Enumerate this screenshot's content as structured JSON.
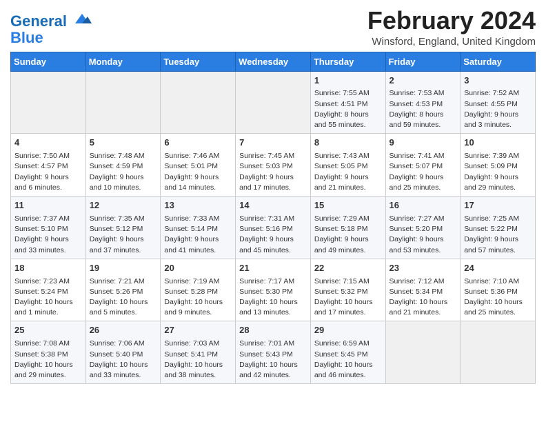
{
  "logo": {
    "line1": "General",
    "line2": "Blue"
  },
  "title": "February 2024",
  "location": "Winsford, England, United Kingdom",
  "days_of_week": [
    "Sunday",
    "Monday",
    "Tuesday",
    "Wednesday",
    "Thursday",
    "Friday",
    "Saturday"
  ],
  "weeks": [
    [
      {
        "day": "",
        "content": ""
      },
      {
        "day": "",
        "content": ""
      },
      {
        "day": "",
        "content": ""
      },
      {
        "day": "",
        "content": ""
      },
      {
        "day": "1",
        "content": "Sunrise: 7:55 AM\nSunset: 4:51 PM\nDaylight: 8 hours\nand 55 minutes."
      },
      {
        "day": "2",
        "content": "Sunrise: 7:53 AM\nSunset: 4:53 PM\nDaylight: 8 hours\nand 59 minutes."
      },
      {
        "day": "3",
        "content": "Sunrise: 7:52 AM\nSunset: 4:55 PM\nDaylight: 9 hours\nand 3 minutes."
      }
    ],
    [
      {
        "day": "4",
        "content": "Sunrise: 7:50 AM\nSunset: 4:57 PM\nDaylight: 9 hours\nand 6 minutes."
      },
      {
        "day": "5",
        "content": "Sunrise: 7:48 AM\nSunset: 4:59 PM\nDaylight: 9 hours\nand 10 minutes."
      },
      {
        "day": "6",
        "content": "Sunrise: 7:46 AM\nSunset: 5:01 PM\nDaylight: 9 hours\nand 14 minutes."
      },
      {
        "day": "7",
        "content": "Sunrise: 7:45 AM\nSunset: 5:03 PM\nDaylight: 9 hours\nand 17 minutes."
      },
      {
        "day": "8",
        "content": "Sunrise: 7:43 AM\nSunset: 5:05 PM\nDaylight: 9 hours\nand 21 minutes."
      },
      {
        "day": "9",
        "content": "Sunrise: 7:41 AM\nSunset: 5:07 PM\nDaylight: 9 hours\nand 25 minutes."
      },
      {
        "day": "10",
        "content": "Sunrise: 7:39 AM\nSunset: 5:09 PM\nDaylight: 9 hours\nand 29 minutes."
      }
    ],
    [
      {
        "day": "11",
        "content": "Sunrise: 7:37 AM\nSunset: 5:10 PM\nDaylight: 9 hours\nand 33 minutes."
      },
      {
        "day": "12",
        "content": "Sunrise: 7:35 AM\nSunset: 5:12 PM\nDaylight: 9 hours\nand 37 minutes."
      },
      {
        "day": "13",
        "content": "Sunrise: 7:33 AM\nSunset: 5:14 PM\nDaylight: 9 hours\nand 41 minutes."
      },
      {
        "day": "14",
        "content": "Sunrise: 7:31 AM\nSunset: 5:16 PM\nDaylight: 9 hours\nand 45 minutes."
      },
      {
        "day": "15",
        "content": "Sunrise: 7:29 AM\nSunset: 5:18 PM\nDaylight: 9 hours\nand 49 minutes."
      },
      {
        "day": "16",
        "content": "Sunrise: 7:27 AM\nSunset: 5:20 PM\nDaylight: 9 hours\nand 53 minutes."
      },
      {
        "day": "17",
        "content": "Sunrise: 7:25 AM\nSunset: 5:22 PM\nDaylight: 9 hours\nand 57 minutes."
      }
    ],
    [
      {
        "day": "18",
        "content": "Sunrise: 7:23 AM\nSunset: 5:24 PM\nDaylight: 10 hours\nand 1 minute."
      },
      {
        "day": "19",
        "content": "Sunrise: 7:21 AM\nSunset: 5:26 PM\nDaylight: 10 hours\nand 5 minutes."
      },
      {
        "day": "20",
        "content": "Sunrise: 7:19 AM\nSunset: 5:28 PM\nDaylight: 10 hours\nand 9 minutes."
      },
      {
        "day": "21",
        "content": "Sunrise: 7:17 AM\nSunset: 5:30 PM\nDaylight: 10 hours\nand 13 minutes."
      },
      {
        "day": "22",
        "content": "Sunrise: 7:15 AM\nSunset: 5:32 PM\nDaylight: 10 hours\nand 17 minutes."
      },
      {
        "day": "23",
        "content": "Sunrise: 7:12 AM\nSunset: 5:34 PM\nDaylight: 10 hours\nand 21 minutes."
      },
      {
        "day": "24",
        "content": "Sunrise: 7:10 AM\nSunset: 5:36 PM\nDaylight: 10 hours\nand 25 minutes."
      }
    ],
    [
      {
        "day": "25",
        "content": "Sunrise: 7:08 AM\nSunset: 5:38 PM\nDaylight: 10 hours\nand 29 minutes."
      },
      {
        "day": "26",
        "content": "Sunrise: 7:06 AM\nSunset: 5:40 PM\nDaylight: 10 hours\nand 33 minutes."
      },
      {
        "day": "27",
        "content": "Sunrise: 7:03 AM\nSunset: 5:41 PM\nDaylight: 10 hours\nand 38 minutes."
      },
      {
        "day": "28",
        "content": "Sunrise: 7:01 AM\nSunset: 5:43 PM\nDaylight: 10 hours\nand 42 minutes."
      },
      {
        "day": "29",
        "content": "Sunrise: 6:59 AM\nSunset: 5:45 PM\nDaylight: 10 hours\nand 46 minutes."
      },
      {
        "day": "",
        "content": ""
      },
      {
        "day": "",
        "content": ""
      }
    ]
  ]
}
